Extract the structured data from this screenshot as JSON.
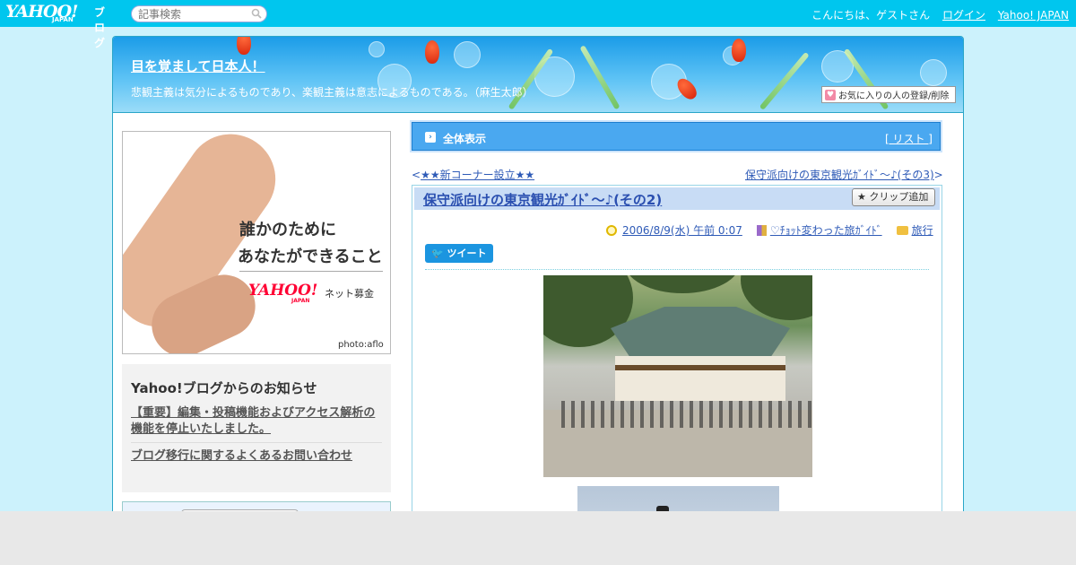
{
  "header": {
    "logo_text": "YAHOO!",
    "logo_sub": "JAPAN",
    "logo_blog": "ブログ",
    "search_placeholder": "記事検索",
    "greeting": "こんにちは、ゲストさん",
    "login": "ログイン",
    "yahoo_japan": "Yahoo! JAPAN"
  },
  "banner": {
    "title": "目を覚まして日本人！",
    "description": "悲観主義は気分によるものであり、楽観主義は意志によるものである。（麻生太郎）",
    "favorite_button": "お気に入りの人の登録/削除"
  },
  "ad": {
    "line1": "誰かのために",
    "line2": "あなたができること",
    "logo": "YAHOO!",
    "logo_sub": "JAPAN",
    "service": "ネット募金",
    "credit": "photo:aflo"
  },
  "notice": {
    "title": "Yahoo!ブログからのお知らせ",
    "items": [
      "【重要】編集・投稿機能およびアクセス解析の機能を停止いたしました。",
      "ブログ移行に関するよくあるお問い合わせ"
    ]
  },
  "main": {
    "all_label": "全体表示",
    "list_link": "[ リスト ]",
    "prev_link": "★★新コーナー設立★★",
    "prev_arrow": "<",
    "next_link": "保守派向けの東京観光ｶﾞｲﾄﾞ〜♪(その3)",
    "next_arrow": ">",
    "post": {
      "title": "保守派向けの東京観光ｶﾞｲﾄﾞ〜♪(その2)",
      "clip_button": "クリップ追加",
      "date": "2006/8/9(水) 午前 0:07",
      "category": "♡ﾁｮｯﾄ変わった旅ｶﾞｲﾄﾞ",
      "folder": "旅行",
      "tweet": "ツイート"
    }
  },
  "colors": {
    "topbar": "#00c6ee",
    "page_bg": "#ccf2fc",
    "link": "#2f5bb7",
    "bar_blue": "#4aa8f0"
  }
}
